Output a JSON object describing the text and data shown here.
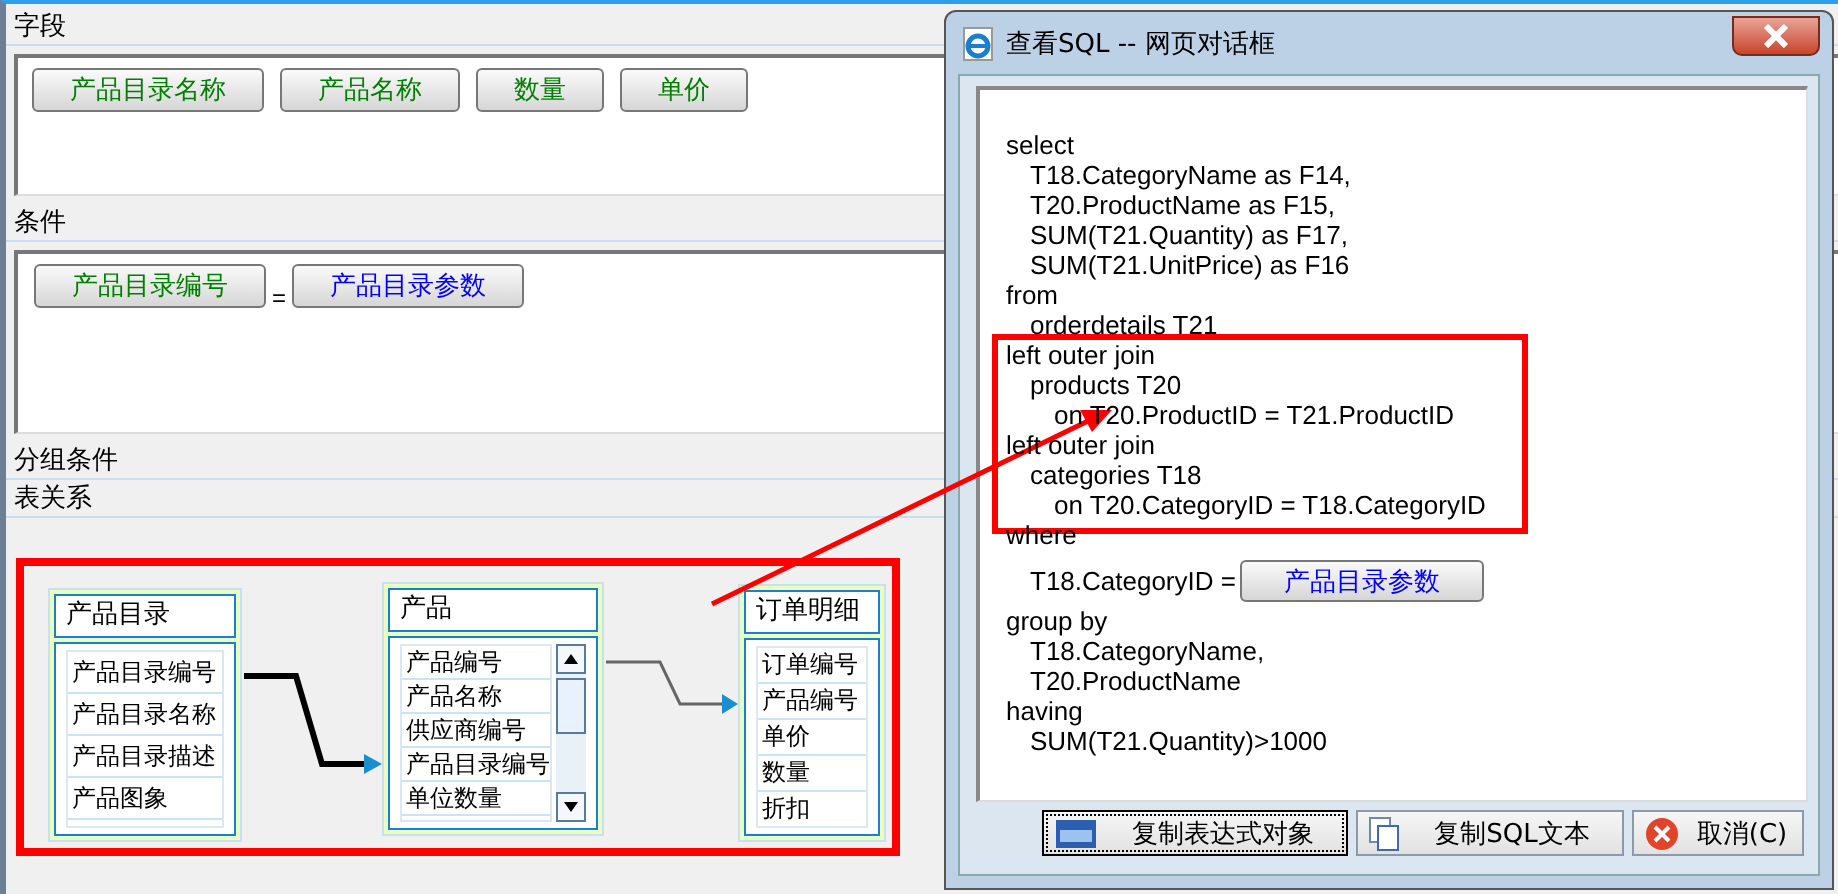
{
  "fields": {
    "title": "字段",
    "items": [
      {
        "label": "产品目录名称",
        "kind": "field"
      },
      {
        "label": "产品名称",
        "kind": "field"
      },
      {
        "label": "数量",
        "kind": "field"
      },
      {
        "label": "单价",
        "kind": "field"
      }
    ]
  },
  "conditions": {
    "title": "条件",
    "items": [
      {
        "label": "产品目录编号",
        "kind": "field"
      },
      {
        "label": "=",
        "kind": "operator"
      },
      {
        "label": "产品目录参数",
        "kind": "param"
      }
    ]
  },
  "grouping": {
    "title": "分组条件"
  },
  "relations": {
    "title": "表关系",
    "tables": [
      {
        "title": "产品目录",
        "scrollbar": false,
        "columns": [
          "产品目录编号",
          "产品目录名称",
          "产品目录描述",
          "产品图象"
        ]
      },
      {
        "title": "产品",
        "scrollbar": true,
        "columns": [
          "产品编号",
          "产品名称",
          "供应商编号",
          "产品目录编号",
          "单位数量"
        ]
      },
      {
        "title": "订单明细",
        "scrollbar": false,
        "columns": [
          "订单编号",
          "产品编号",
          "单价",
          "数量",
          "折扣"
        ]
      }
    ]
  },
  "dialog": {
    "title": "查看SQL -- 网页对话框",
    "sql": [
      {
        "text": "select",
        "children": [
          {
            "text": "T18.CategoryName as F14,"
          },
          {
            "text": "T20.ProductName as F15,"
          },
          {
            "text": "SUM(T21.Quantity) as F17,"
          },
          {
            "text": "SUM(T21.UnitPrice) as F16"
          }
        ]
      },
      {
        "text": "from",
        "children": [
          {
            "text": "orderdetails T21"
          }
        ]
      },
      {
        "text": "left outer join",
        "children": [
          {
            "text": "products T20",
            "children": [
              {
                "text": "on T20.ProductID = T21.ProductID"
              }
            ]
          }
        ]
      },
      {
        "text": "left outer join",
        "children": [
          {
            "text": "categories T18",
            "children": [
              {
                "text": "on T20.CategoryID = T18.CategoryID"
              }
            ]
          }
        ]
      },
      {
        "text": "where",
        "children": [
          {
            "text": "T18.CategoryID =",
            "param": "产品目录参数"
          }
        ]
      },
      {
        "text": "group by",
        "children": [
          {
            "text": "T18.CategoryName,"
          },
          {
            "text": "T20.ProductName"
          }
        ]
      },
      {
        "text": "having",
        "children": [
          {
            "text": "SUM(T21.Quantity)>1000"
          }
        ]
      }
    ],
    "buttons": [
      {
        "label": "复制表达式对象",
        "kind": "html",
        "focused": true
      },
      {
        "label": "复制SQL文本",
        "kind": "copy",
        "focused": false
      },
      {
        "label": "取消(C)",
        "kind": "cancel",
        "focused": false
      }
    ]
  }
}
